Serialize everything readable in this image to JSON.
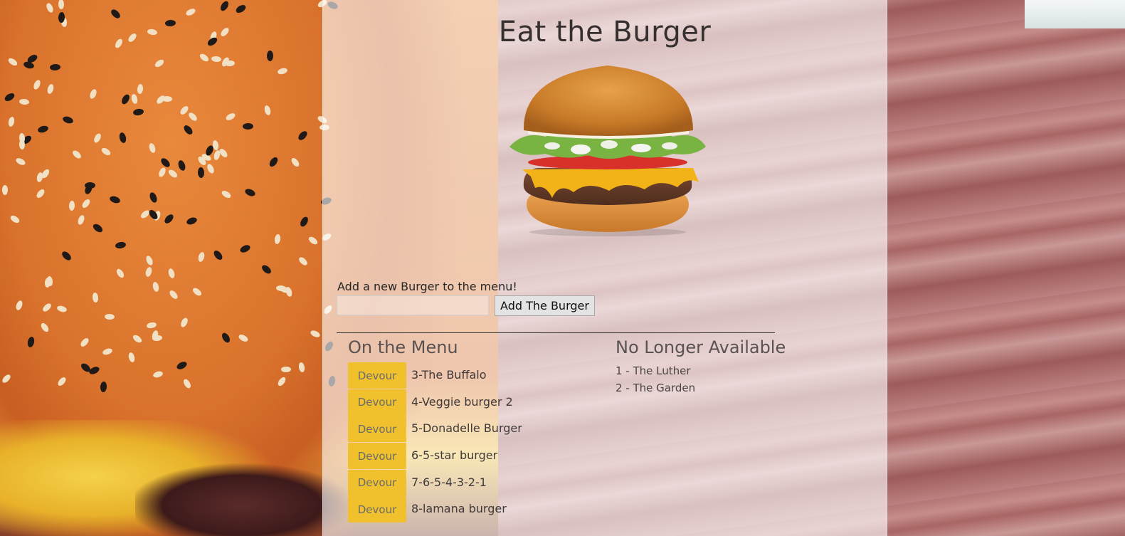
{
  "page": {
    "title": "Eat the Burger"
  },
  "add_form": {
    "label": "Add a new Burger to the menu!",
    "input_value": "",
    "button_label": "Add The Burger"
  },
  "on_menu": {
    "heading": "On the Menu",
    "button_label": "Devour",
    "items": [
      {
        "name": "3-The Buffalo"
      },
      {
        "name": "4-Veggie burger 2"
      },
      {
        "name": "5-Donadelle Burger"
      },
      {
        "name": "6-5-star burger"
      },
      {
        "name": "7-6-5-4-3-2-1"
      },
      {
        "name": "8-lamana burger"
      }
    ]
  },
  "no_longer": {
    "heading": "No Longer Available",
    "items": [
      {
        "name": "1 - The Luther"
      },
      {
        "name": "2 - The Garden"
      }
    ]
  },
  "colors": {
    "devour_button": "#f0c12c",
    "panel_overlay": "rgba(255,255,255,0.62)"
  },
  "icons": {
    "hero": "burger-image"
  }
}
